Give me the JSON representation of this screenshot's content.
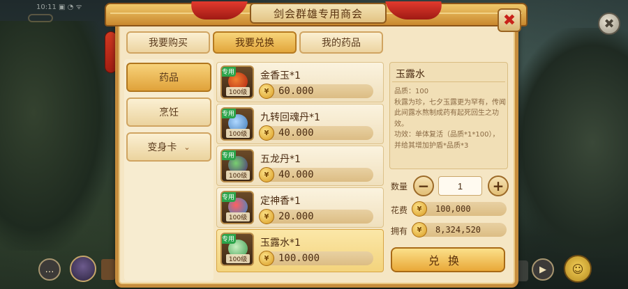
{
  "status_bar": {
    "text": "10:11 ▣ ◔ ᯤ"
  },
  "dialog": {
    "title": "剑会群雄专用商会",
    "close_glyph": "✖"
  },
  "outer_close_glyph": "✖",
  "tabs": [
    {
      "label": "我要购买",
      "active": false
    },
    {
      "label": "我要兑换",
      "active": true
    },
    {
      "label": "我的药品",
      "active": false
    }
  ],
  "categories": [
    {
      "label": "药品",
      "active": true
    },
    {
      "label": "烹饪",
      "active": false
    },
    {
      "label": "变身卡",
      "active": false,
      "chevron": "⌄"
    }
  ],
  "items": [
    {
      "name": "金香玉*1",
      "tag": "专用",
      "level": "100级",
      "price": "60.000",
      "selected": false
    },
    {
      "name": "九转回魂丹*1",
      "tag": "专用",
      "level": "100级",
      "price": "40.000",
      "selected": false
    },
    {
      "name": "五龙丹*1",
      "tag": "专用",
      "level": "100级",
      "price": "40.000",
      "selected": false
    },
    {
      "name": "定神香*1",
      "tag": "专用",
      "level": "100级",
      "price": "20.000",
      "selected": false
    },
    {
      "name": "玉露水*1",
      "tag": "专用",
      "level": "100级",
      "price": "100.000",
      "selected": true
    }
  ],
  "detail": {
    "title": "玉露水",
    "description": "品质：100\n秋露为珍，七夕玉露更为罕有，传闻此间露水熬制成药有起死回生之功效。\n功效：单体复活（品质*1*100），并给其增加护盾*品质*3"
  },
  "quantity": {
    "label": "数量",
    "value": "1",
    "minus": "−",
    "plus": "+"
  },
  "cost": {
    "label": "花费",
    "value": "100,000"
  },
  "owned": {
    "label": "拥有",
    "value": "8,324,520"
  },
  "coin_glyph": "¥",
  "exchange_button": "兑换",
  "hud": {
    "chat_glyph": "…",
    "video_glyph": "▶",
    "user_glyph": "☺"
  },
  "colors": {
    "accent": "#e2a63b",
    "frame": "#c68d3d",
    "tag_green": "#2aa44a",
    "close_red": "#c8221a"
  }
}
